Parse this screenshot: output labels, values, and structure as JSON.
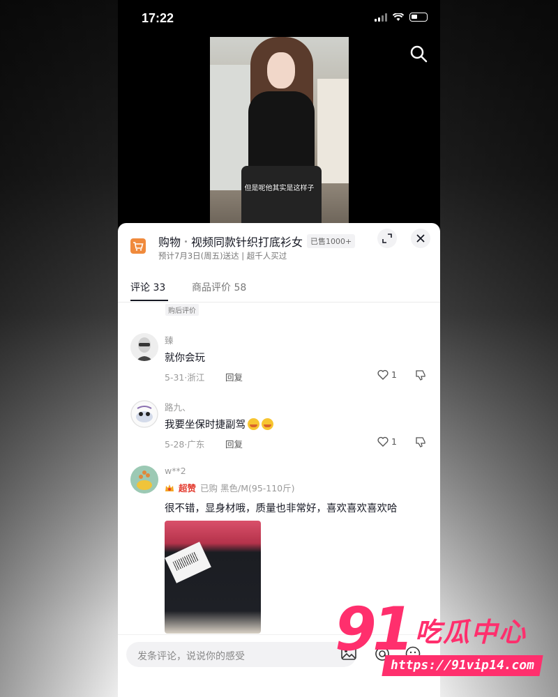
{
  "status_bar": {
    "time": "17:22"
  },
  "video": {
    "caption": "但是呢他其实是这样子"
  },
  "product": {
    "shop_label": "购物",
    "title": "视频同款针织打底衫女",
    "sold_badge": "已售1000+",
    "delivery": "预计7月3日(周五)送达 | 超千人买过"
  },
  "tabs": [
    {
      "label": "评论 33",
      "active": true
    },
    {
      "label": "商品评价 58",
      "active": false
    }
  ],
  "after_purchase_tag": "购后评价",
  "comments": [
    {
      "name": "臻",
      "text": "就你会玩",
      "meta": "5-31·浙江",
      "reply": "回复",
      "likes": "1"
    },
    {
      "name": "路九、",
      "text": "我要坐保时捷副驾",
      "meta": "5-28·广东",
      "reply": "回复",
      "likes": "1",
      "emoji_count": 2
    },
    {
      "name": "w**2",
      "badge": "超赞",
      "purchase_info": "已购 黑色/M(95-110斤)",
      "text": "很不错，显身材哦，质量也非常好，喜欢喜欢喜欢哈"
    }
  ],
  "input": {
    "placeholder": "发条评论，说说你的感受"
  },
  "watermark": {
    "number": "91",
    "brand": "吃瓜中心",
    "url": "https://91vip14.com"
  },
  "colors": {
    "accent": "#ff2f6d",
    "cart": "#f08a3c",
    "hot": "#e33a2e",
    "text": "#161823"
  },
  "icons": [
    "search-icon",
    "cart-icon",
    "expand-icon",
    "close-icon",
    "heart-icon",
    "dislike-icon",
    "crown-icon",
    "image-icon",
    "at-icon",
    "emoji-icon"
  ]
}
